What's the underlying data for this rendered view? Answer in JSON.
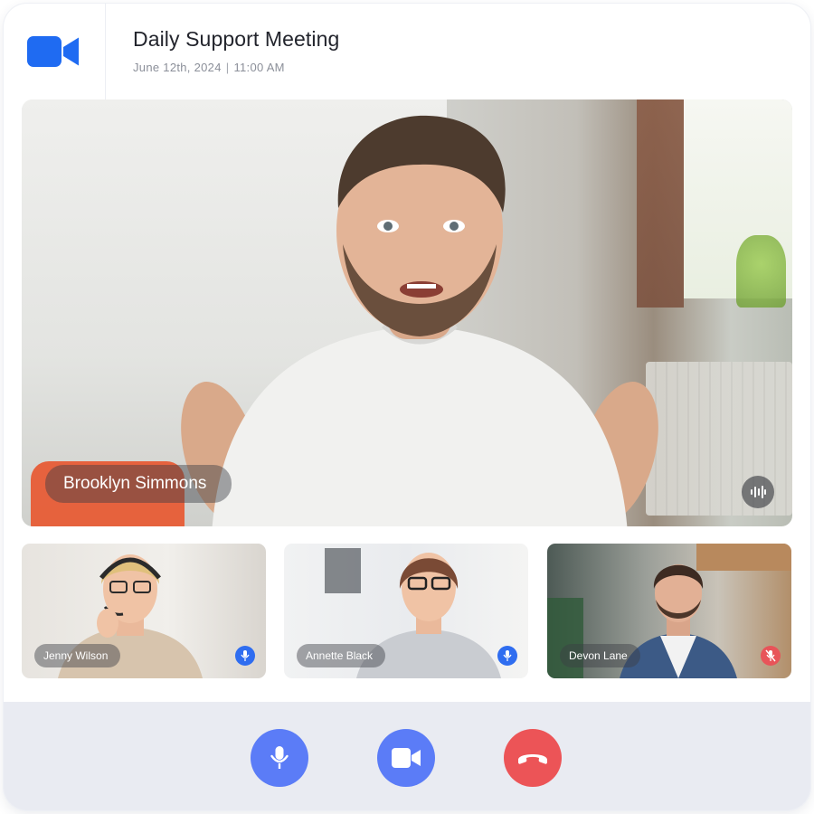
{
  "meeting": {
    "title": "Daily Support Meeting",
    "date": "June 12th, 2024",
    "time": "11:00 AM"
  },
  "main_speaker": {
    "name": "Brooklyn Simmons",
    "audio_indicator_icon": "audio-waveform-icon"
  },
  "participants": [
    {
      "name": "Jenny Wilson",
      "mic_icon": "mic-icon",
      "mic_muted": false,
      "badge_color": "#2f6df0"
    },
    {
      "name": "Annette Black",
      "mic_icon": "mic-icon",
      "mic_muted": false,
      "badge_color": "#2f6df0"
    },
    {
      "name": "Devon Lane",
      "mic_icon": "mic-off-icon",
      "mic_muted": true,
      "badge_color": "#e85459"
    }
  ],
  "controls": {
    "mic_icon": "mic-icon",
    "camera_icon": "video-camera-icon",
    "end_call_icon": "phone-hangup-icon"
  },
  "colors": {
    "brand": "#1f6bf2",
    "control_blue": "#5b7cf7",
    "end_call_red": "#ec5457",
    "control_bar_bg": "#e9ebf2"
  }
}
